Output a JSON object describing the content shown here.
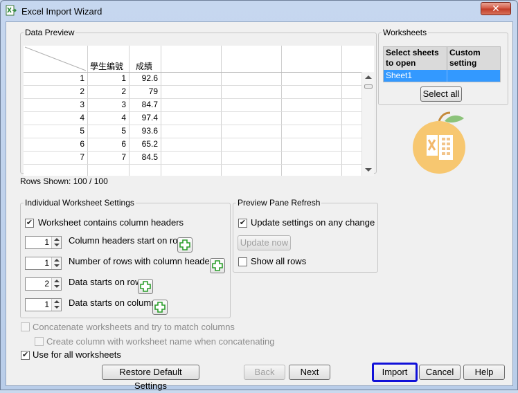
{
  "window": {
    "title": "Excel Import Wizard",
    "close_label": "✕"
  },
  "data_preview": {
    "legend": "Data Preview",
    "columns": [
      "學生編號",
      "成績"
    ],
    "rows": [
      [
        "1",
        "1",
        "92.6"
      ],
      [
        "2",
        "2",
        "79"
      ],
      [
        "3",
        "3",
        "84.7"
      ],
      [
        "4",
        "4",
        "97.4"
      ],
      [
        "5",
        "5",
        "93.6"
      ],
      [
        "6",
        "6",
        "65.2"
      ],
      [
        "7",
        "7",
        "84.5"
      ]
    ]
  },
  "rows_shown": "Rows Shown: 100 / 100",
  "worksheets": {
    "legend": "Worksheets",
    "col1": "Select sheets to open",
    "col2": "Custom setting",
    "sheet": "Sheet1",
    "select_all": "Select all"
  },
  "individual": {
    "legend": "Individual Worksheet Settings",
    "contains_headers": "Worksheet contains column headers",
    "headers_start_label": "Column headers start on row",
    "headers_start_value": "1",
    "num_header_rows_label": "Number of rows with column headers",
    "num_header_rows_value": "1",
    "data_row_label": "Data starts on row",
    "data_row_value": "2",
    "data_col_label": "Data starts on column",
    "data_col_value": "1"
  },
  "refresh": {
    "legend": "Preview Pane Refresh",
    "update_any": "Update settings on any change",
    "update_now": "Update now",
    "show_all": "Show all rows"
  },
  "options": {
    "concatenate": "Concatenate worksheets and try to match columns",
    "create_column": "Create column with worksheet name when concatenating",
    "use_all": "Use for all worksheets"
  },
  "buttons": {
    "restore": "Restore Default Settings",
    "back": "Back",
    "next": "Next",
    "import": "Import",
    "cancel": "Cancel",
    "help": "Help"
  },
  "colors": {
    "selection": "#3399ff",
    "focus_border": "#1010d8",
    "logo_orange": "#f7c770"
  }
}
